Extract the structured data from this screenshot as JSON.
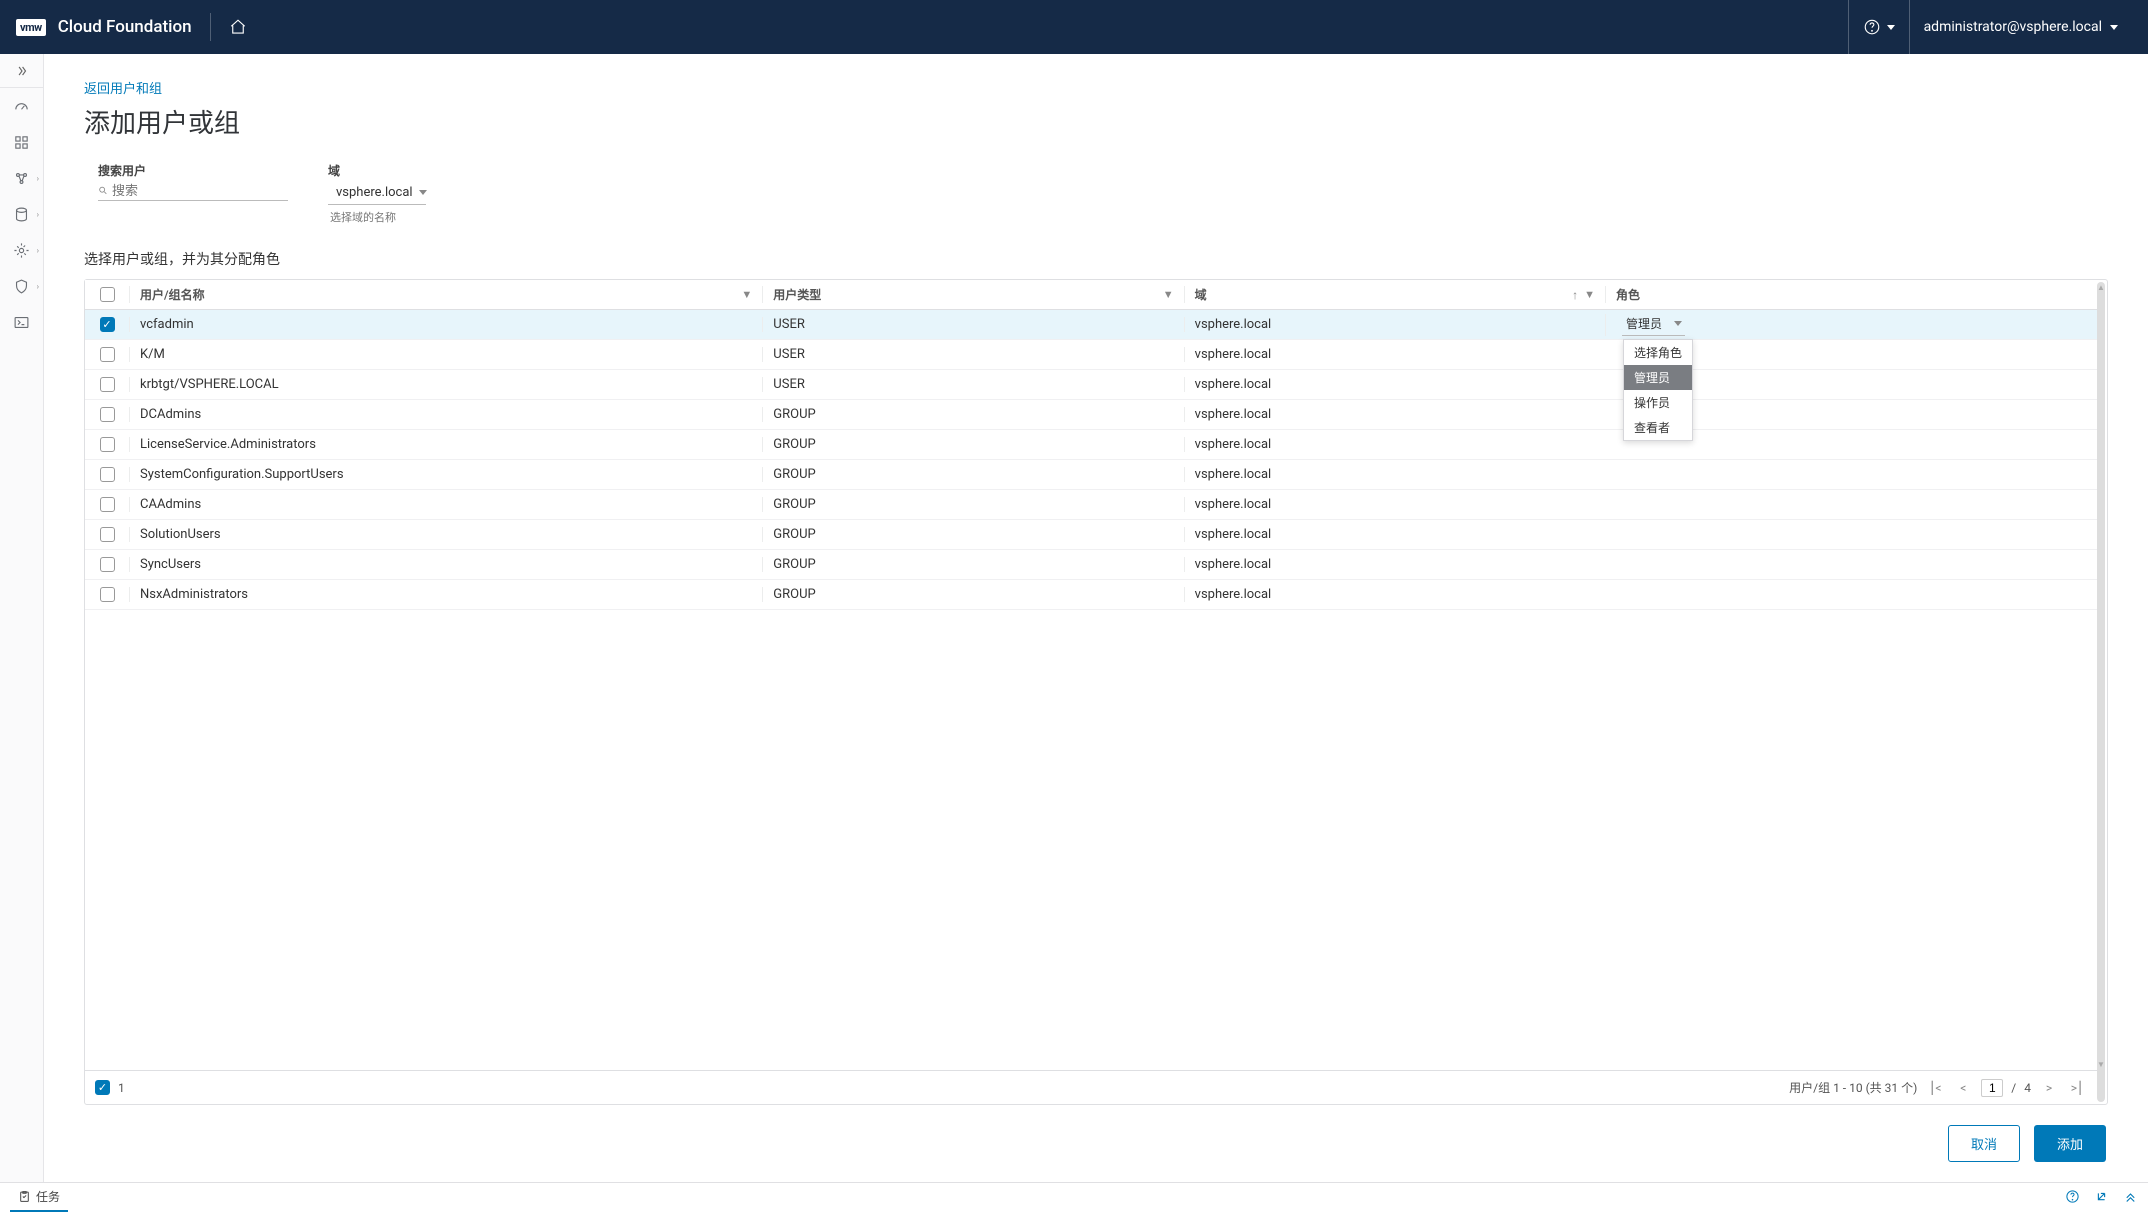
{
  "header": {
    "logo": "vmw",
    "brand": "Cloud Foundation",
    "user": "administrator@vsphere.local"
  },
  "page": {
    "back_link": "返回用户和组",
    "title": "添加用户或组",
    "search_label": "搜索用户",
    "search_placeholder": "搜索",
    "domain_label": "域",
    "domain_value": "vsphere.local",
    "domain_helper": "选择域的名称",
    "table_desc": "选择用户或组，并为其分配角色",
    "cancel": "取消",
    "add": "添加"
  },
  "columns": {
    "name": "用户/组名称",
    "type": "用户类型",
    "domain": "域",
    "role": "角色"
  },
  "role_button": "管理员",
  "role_options": [
    "选择角色",
    "管理员",
    "操作员",
    "查看者"
  ],
  "rows": [
    {
      "checked": true,
      "name": "vcfadmin",
      "type": "USER",
      "domain": "vsphere.local",
      "role_shown": true
    },
    {
      "checked": false,
      "name": "K/M",
      "type": "USER",
      "domain": "vsphere.local"
    },
    {
      "checked": false,
      "name": "krbtgt/VSPHERE.LOCAL",
      "type": "USER",
      "domain": "vsphere.local"
    },
    {
      "checked": false,
      "name": "DCAdmins",
      "type": "GROUP",
      "domain": "vsphere.local"
    },
    {
      "checked": false,
      "name": "LicenseService.Administrators",
      "type": "GROUP",
      "domain": "vsphere.local"
    },
    {
      "checked": false,
      "name": "SystemConfiguration.SupportUsers",
      "type": "GROUP",
      "domain": "vsphere.local"
    },
    {
      "checked": false,
      "name": "CAAdmins",
      "type": "GROUP",
      "domain": "vsphere.local"
    },
    {
      "checked": false,
      "name": "SolutionUsers",
      "type": "GROUP",
      "domain": "vsphere.local"
    },
    {
      "checked": false,
      "name": "SyncUsers",
      "type": "GROUP",
      "domain": "vsphere.local"
    },
    {
      "checked": false,
      "name": "NsxAdministrators",
      "type": "GROUP",
      "domain": "vsphere.local"
    }
  ],
  "footer": {
    "selected_count": "1",
    "range_text": "用户/组 1 - 10 (共 31 个)",
    "page_current": "1",
    "page_sep": "/",
    "page_total": "4"
  },
  "bottom": {
    "task": "任务"
  }
}
